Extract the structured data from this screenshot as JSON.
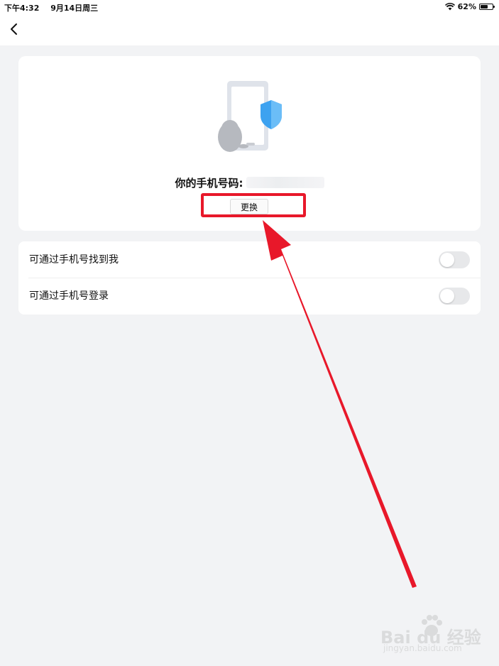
{
  "status_bar": {
    "time": "下午4:32",
    "date": "9月14日周三",
    "battery_percent": "62%",
    "battery_level": 0.62,
    "icons": [
      "wifi-icon",
      "battery-icon"
    ]
  },
  "nav": {
    "back_icon": "chevron-left-icon"
  },
  "phone_card": {
    "illustration_icon": "phone-shield-icon",
    "phone_label": "你的手机号码:",
    "phone_number_masked": "",
    "change_button_label": "更换"
  },
  "settings": {
    "items": [
      {
        "label": "可通过手机号找到我",
        "enabled": false
      },
      {
        "label": "可通过手机号登录",
        "enabled": false
      }
    ]
  },
  "annotation": {
    "color": "#e8182a",
    "shape": "arrow pointing to change button with highlight box"
  },
  "watermark": {
    "logo_text": "Bai du 经验",
    "url_text": "jingyan.baidu.com"
  }
}
